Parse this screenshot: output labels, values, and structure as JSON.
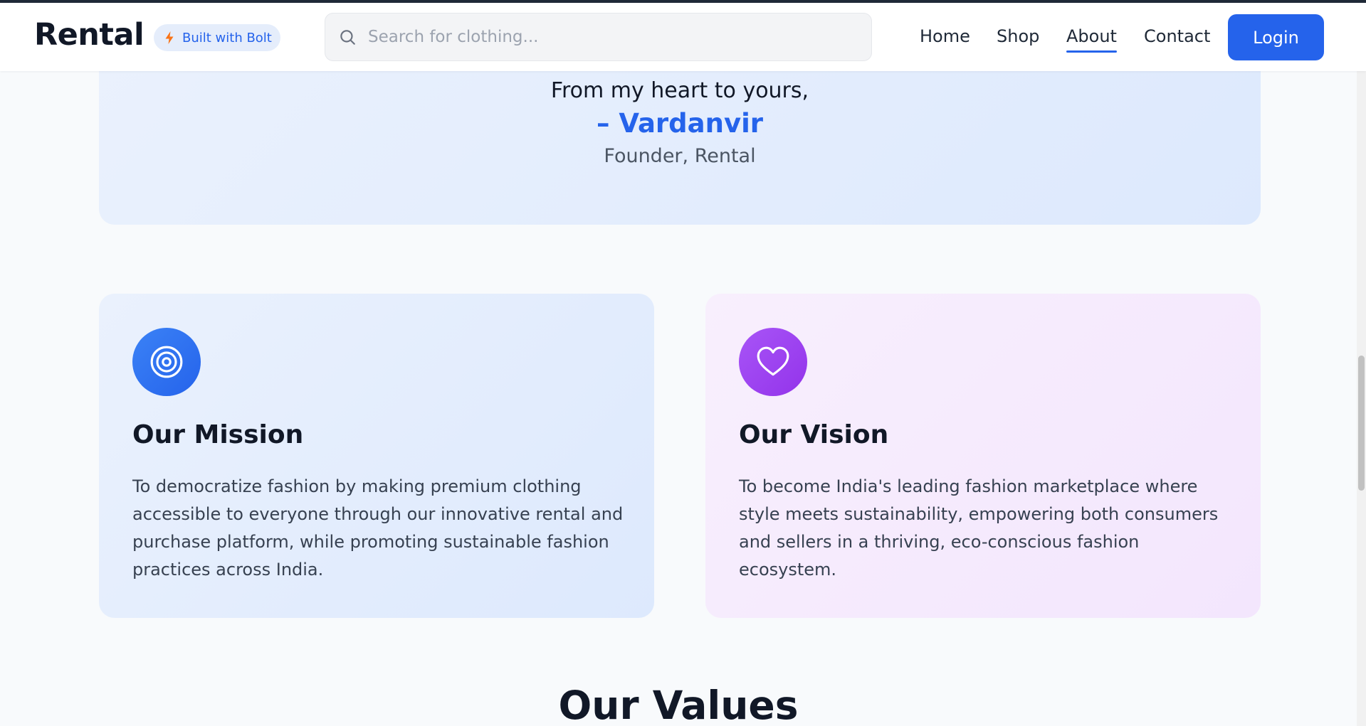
{
  "header": {
    "brand": "Rental",
    "badge_label": "Built with Bolt",
    "search_placeholder": "Search for clothing...",
    "nav": [
      {
        "label": "Home",
        "active": false
      },
      {
        "label": "Shop",
        "active": false
      },
      {
        "label": "About",
        "active": true
      },
      {
        "label": "Contact",
        "active": false
      }
    ],
    "login_label": "Login"
  },
  "founder": {
    "closing_line": "From my heart to yours,",
    "signature": "– Vardanvir",
    "role": "Founder, Rental"
  },
  "mission": {
    "icon": "target-icon",
    "title": "Our Mission",
    "body": "To democratize fashion by making premium clothing accessible to everyone through our innovative rental and purchase platform, while promoting sustainable fashion practices across India."
  },
  "vision": {
    "icon": "heart-icon",
    "title": "Our Vision",
    "body": "To become India's leading fashion marketplace where style meets sustainability, empowering both consumers and sellers in a thriving, eco-conscious fashion ecosystem."
  },
  "values": {
    "title": "Our Values"
  },
  "colors": {
    "accent": "#2563eb",
    "vision_accent": "#9333ea",
    "text_dark": "#111827"
  }
}
